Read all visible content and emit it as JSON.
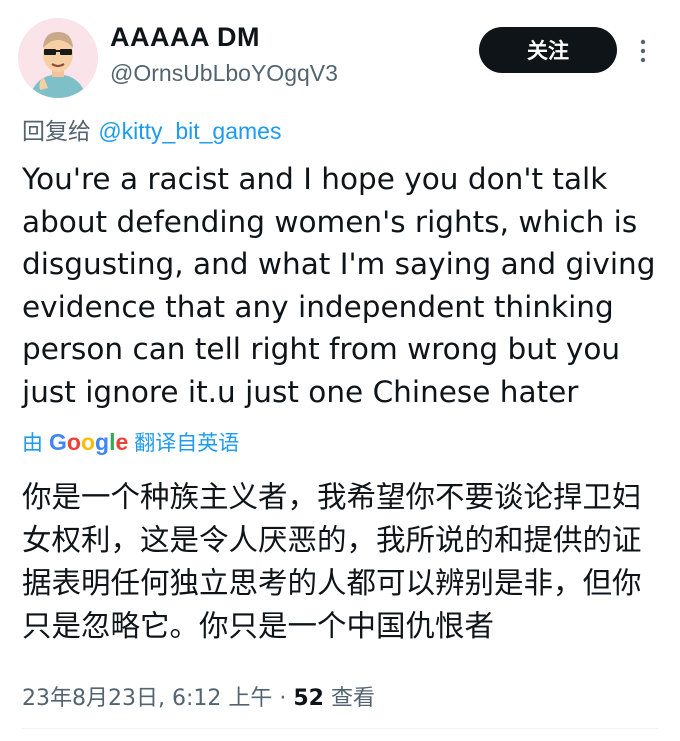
{
  "author": {
    "display_name": "AAAAA DM",
    "handle": "@OrnsUbLboYOgqV3"
  },
  "header": {
    "follow_label": "关注"
  },
  "reply": {
    "prefix": "回复给 ",
    "mention": "@kitty_bit_games"
  },
  "tweet": {
    "text": "You're a racist and I hope you don't talk about defending women's rights, which is disgusting, and what I'm saying and giving evidence that any independent thinking person can tell right from wrong but you just ignore it.u just one Chinese hater"
  },
  "translation": {
    "by": "由",
    "provider": "Google",
    "link_label": "翻译自英语",
    "text": "你是一个种族主义者，我希望你不要谈论捍卫妇女权利，这是令人厌恶的，我所说的和提供的证据表明任何独立思考的人都可以辨别是非，但你只是忽略它。你只是一个中国仇恨者"
  },
  "meta": {
    "timestamp": "23年8月23日, 6:12 上午",
    "separator": " · ",
    "views_count": "52",
    "views_label": " 查看"
  },
  "colors": {
    "accent": "#1d9bf0",
    "secondary_text": "#536471",
    "primary_text": "#0f1419",
    "avatar_bg": "#fbe3ea"
  }
}
